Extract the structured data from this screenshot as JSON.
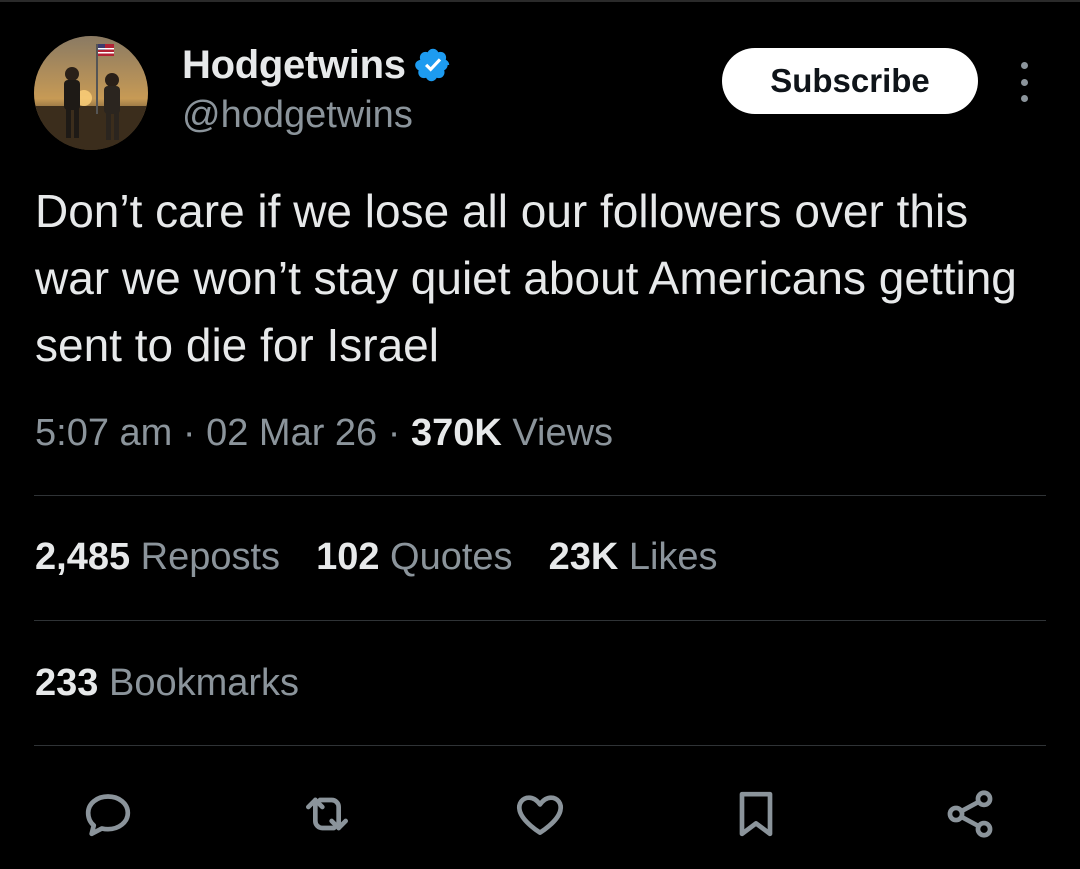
{
  "author": {
    "name": "Hodgetwins",
    "handle": "@hodgetwins",
    "verified": true,
    "avatar_icon": "avatar-photo-two-men-with-american-flag"
  },
  "header": {
    "subscribe_label": "Subscribe",
    "more_icon": "more-options-icon"
  },
  "tweet": {
    "text": "Don’t care if we lose all our followers over this war we won’t stay quiet about Americans getting sent to die for Israel",
    "time": "5:07 am",
    "date": "02 Mar 26",
    "views_count": "370K",
    "views_label": "Views",
    "separator": "·"
  },
  "stats": {
    "reposts_count": "2,485",
    "reposts_label": "Reposts",
    "quotes_count": "102",
    "quotes_label": "Quotes",
    "likes_count": "23K",
    "likes_label": "Likes",
    "bookmarks_count": "233",
    "bookmarks_label": "Bookmarks"
  },
  "actions": [
    "reply-icon",
    "repost-icon",
    "like-icon",
    "bookmark-icon",
    "share-icon"
  ],
  "colors": {
    "background": "#000000",
    "text": "#e7e9ea",
    "secondary": "#8b949b",
    "divider": "#2f3336",
    "verified": "#1d9bf0",
    "button_bg": "#ffffff"
  }
}
